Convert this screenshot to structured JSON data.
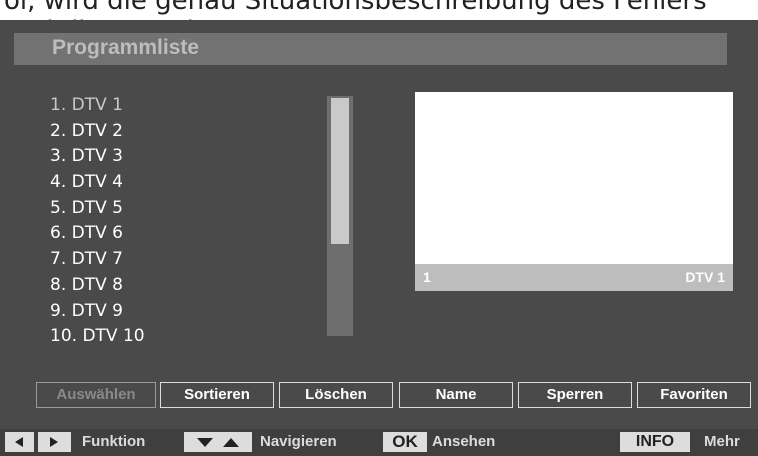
{
  "caption": "ol, wird die genau Situationsbeschreibung des Fehlers und die Umgebung",
  "title": "Programmliste",
  "channels": [
    {
      "label": "1. DTV 1"
    },
    {
      "label": "2. DTV 2"
    },
    {
      "label": "3. DTV 3"
    },
    {
      "label": "4. DTV 4"
    },
    {
      "label": "5. DTV 5"
    },
    {
      "label": "6. DTV 6"
    },
    {
      "label": "7. DTV 7"
    },
    {
      "label": "8. DTV 8"
    },
    {
      "label": "9. DTV 9"
    },
    {
      "label": "10. DTV 10"
    }
  ],
  "selected_channel": "1. DTV 1",
  "scroll_fraction_visible": 0.62,
  "preview": {
    "number": "1",
    "name": "DTV 1"
  },
  "actions": {
    "select": "Auswählen",
    "sort": "Sortieren",
    "delete": "Löschen",
    "name": "Name",
    "lock": "Sperren",
    "favorites": "Favoriten"
  },
  "footer": {
    "function": "Funktion",
    "navigate": "Navigieren",
    "ok_key": "OK",
    "view": "Ansehen",
    "info_key": "INFO",
    "more": "Mehr"
  },
  "colors": {
    "screen_background": "#4a4a4a",
    "title_bar": "#727272",
    "preview_bar": "#bdbdbd"
  },
  "icons": [
    "arrow-left-icon",
    "arrow-right-icon",
    "arrow-down-icon",
    "arrow-up-icon"
  ]
}
